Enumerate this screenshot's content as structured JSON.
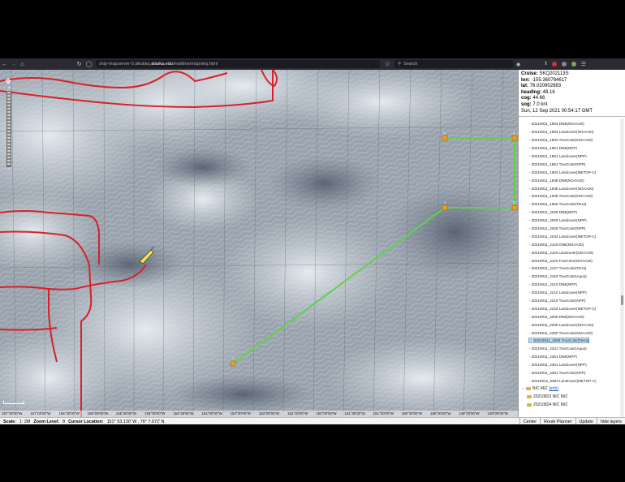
{
  "browser": {
    "url_prefix": "ship-mapserver-0.sikuliaq.",
    "url_domain": "alaska.edu",
    "url_path": "/realtime/map/skq.html",
    "search_placeholder": "Search"
  },
  "ship_info": {
    "cruise_label": "Cruise:",
    "cruise": "SKQ202113S",
    "lon_label": "lon:",
    "lon": "-155.360784617",
    "lat_label": "lat:",
    "lat": "76.020902983",
    "heading_label": "heading:",
    "heading": "48.16",
    "cog_label": "cog:",
    "cog": "44.66",
    "sog_label": "sog:",
    "sog": "7.0 knt",
    "datetime": "Sun, 12 Sep 2021 00:54:17 GMT"
  },
  "layers": [
    "20210911_1803 DNB(NOAA20)",
    "20210911_1803 Landcover(NOAA20)",
    "20210911_1803 TrueColor(NOAA20)",
    "20210911_1851 DNB(NPP)",
    "20210911_1851 Landcover(NPP)",
    "20210911_1851 TrueColor(NPP)",
    "20210911_1903 Landcover(METOP-C)",
    "20210911_1938 DNB(NOAA20)",
    "20210911_1938 Landcover(NOAA20)",
    "20210911_1938 TrueColor(NOAA20)",
    "20210911_1950 TrueColor(Terra)",
    "20210911_2029 DNB(NPP)",
    "20210911_2029 Landcover(NPP)",
    "20210911_2029 TrueColor(NPP)",
    "20210911_2043 Landcover(METOP-C)",
    "20210911_2119 DNB(NOAA20)",
    "20210911_2119 Landcover(NOAA20)",
    "20210911_2119 TrueColor(NOAA20)",
    "20210911_2127 TrueColor(Terra)",
    "20210911_2153 TrueColor(Aqua)",
    "20210911_2210 DNB(NPP)",
    "20210911_2210 Landcover(NPP)",
    "20210911_2210 TrueColor(NPP)",
    "20210911_2223 Landcover(METOP-C)",
    "20210911_2300 DNB(NOAA20)",
    "20210911_2300 Landcover(NOAA20)",
    "20210911_2300 TrueColor(NOAA20)",
    "20210911_2306 TrueColor(Terra)",
    "20210911_2331 TrueColor(Aqua)",
    "20210911_2351 DNB(NPP)",
    "20210911_2351 Landcover(NPP)",
    "20210911_2351 TrueColor(NPP)",
    "20210912_0003 Landcover(METOP-C)"
  ],
  "selected_layer": "20210911_2306 TrueColor(Terra)",
  "groups": {
    "nic_miz": "NIC MIZ",
    "info": "(info)",
    "sub1": "20210823 NIC MIZ",
    "sub2": "20210824 NIC MIZ"
  },
  "waypoints": [
    "1",
    "2",
    "3",
    "4",
    "5"
  ],
  "longitude_labels": [
    "157°30'00\"W",
    "157°00'00\"W",
    "156°30'00\"W",
    "156°00'00\"W",
    "155°30'00\"W",
    "155°00'00\"W",
    "154°30'00\"W",
    "154°00'00\"W",
    "153°30'00\"W",
    "153°00'00\"W",
    "152°30'00\"W",
    "152°00'00\"W",
    "151°30'00\"W",
    "151°00'00\"W",
    "150°30'00\"W",
    "150°00'00\"W",
    "149°30'00\"W",
    "149°00'00\"W"
  ],
  "status": {
    "scale_label": "Scale:",
    "scale": "1: 2M",
    "zoom_label": "Zoom Level:",
    "zoom": "8",
    "cursor_label": "Cursor Location:",
    "cursor": "151° 53.130' W , 76° 7.672' N",
    "center": "Center",
    "route_planner": "Route Planner",
    "update": "Update",
    "hide_layers": "hide layers"
  },
  "colors": {
    "track": "#d8202a",
    "route": "#5fd348",
    "waypoint": "#f0a020"
  }
}
